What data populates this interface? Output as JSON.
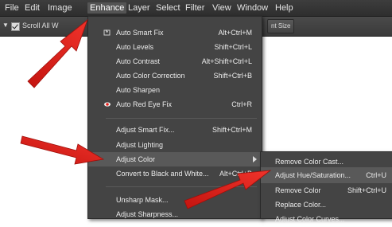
{
  "menubar": {
    "items": [
      "File",
      "Edit",
      "Image",
      "Enhance",
      "Layer",
      "Select",
      "Filter",
      "View",
      "Window",
      "Help"
    ],
    "active_index": 3
  },
  "options_bar": {
    "checkbox_label": "Scroll All W",
    "button_label": "nt Size"
  },
  "enhance_menu": {
    "items": [
      {
        "label": "Auto Smart Fix",
        "shortcut": "Alt+Ctrl+M",
        "icon": "auto-smart-fix-icon"
      },
      {
        "label": "Auto Levels",
        "shortcut": "Shift+Ctrl+L"
      },
      {
        "label": "Auto Contrast",
        "shortcut": "Alt+Shift+Ctrl+L"
      },
      {
        "label": "Auto Color Correction",
        "shortcut": "Shift+Ctrl+B"
      },
      {
        "label": "Auto Sharpen",
        "shortcut": ""
      },
      {
        "label": "Auto Red Eye Fix",
        "shortcut": "Ctrl+R",
        "icon": "red-eye-icon"
      },
      {
        "label": "Adjust Smart Fix...",
        "shortcut": "Shift+Ctrl+M"
      },
      {
        "label": "Adjust Lighting",
        "shortcut": "",
        "submenu": true
      },
      {
        "label": "Adjust Color",
        "shortcut": "",
        "submenu": true,
        "highlighted": true
      },
      {
        "label": "Convert to Black and White...",
        "shortcut": "Alt+Ctrl+B"
      },
      {
        "label": "Unsharp Mask...",
        "shortcut": ""
      },
      {
        "label": "Adjust Sharpness...",
        "shortcut": ""
      }
    ]
  },
  "adjust_color_submenu": {
    "items": [
      {
        "label": "Remove Color Cast...",
        "shortcut": ""
      },
      {
        "label": "Adjust Hue/Saturation...",
        "shortcut": "Ctrl+U",
        "highlighted": true
      },
      {
        "label": "Remove Color",
        "shortcut": "Shift+Ctrl+U"
      },
      {
        "label": "Replace Color...",
        "shortcut": ""
      },
      {
        "label": "Adjust Color Curves...",
        "shortcut": ""
      }
    ]
  },
  "colors": {
    "menu_bg": "#444444",
    "highlight": "#595959",
    "arrow_red": "#e8221e"
  }
}
